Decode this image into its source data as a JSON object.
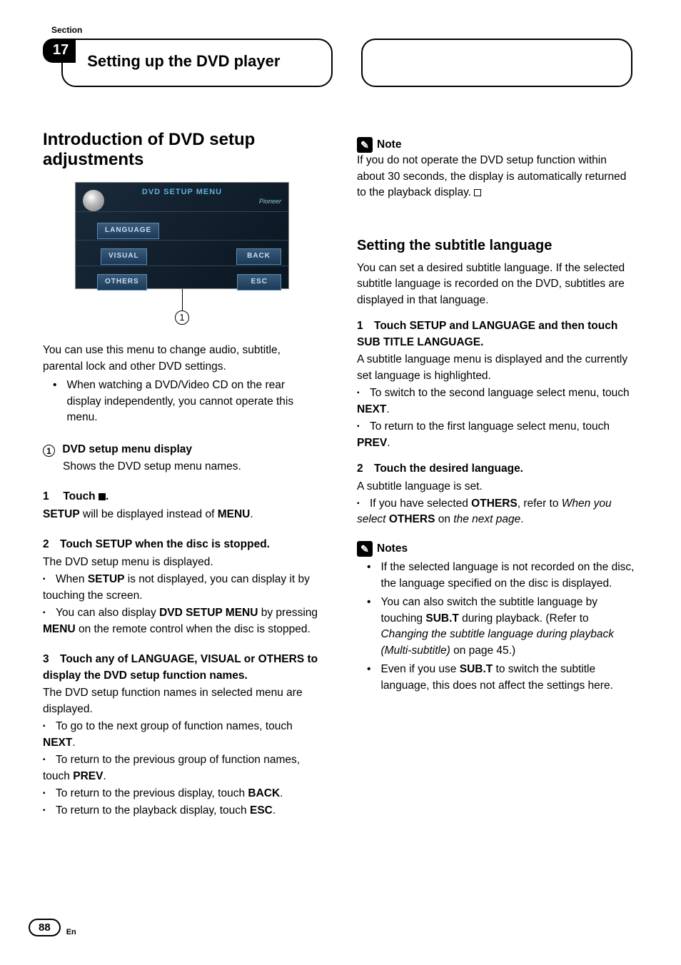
{
  "section_label": "Section",
  "chapter_number": "17",
  "chapter_title": "Setting up the DVD player",
  "page_number": "88",
  "lang_code": "En",
  "left": {
    "h2": "Introduction of DVD setup adjustments",
    "screenshot": {
      "title": "DVD SETUP MENU",
      "brand": "Pioneer",
      "btn_language": "LANGUAGE",
      "btn_visual": "VISUAL",
      "btn_others": "OTHERS",
      "btn_back": "BACK",
      "btn_esc": "ESC"
    },
    "callout": "1",
    "intro1": "You can use this menu to change audio, subtitle, parental lock and other DVD settings.",
    "intro_bullet": "When watching a DVD/Video CD on the rear display independently, you cannot operate this menu.",
    "legend_num": "1",
    "legend_title": "DVD setup menu display",
    "legend_desc": "Shows the DVD setup menu names.",
    "s1_num": "1",
    "s1_head_a": "Touch ",
    "s1_head_b": ".",
    "s1_body_a": "SETUP",
    "s1_body_b": " will be displayed instead of ",
    "s1_body_c": "MENU",
    "s1_body_d": ".",
    "s2_num": "2",
    "s2_head": "Touch SETUP when the disc is stopped.",
    "s2_body": "The DVD setup menu is displayed.",
    "s2_n1_a": "When ",
    "s2_n1_b": "SETUP",
    "s2_n1_c": " is not displayed, you can display it by touching the screen.",
    "s2_n2_a": "You can also display ",
    "s2_n2_b": "DVD SETUP MENU",
    "s2_n2_c": " by pressing ",
    "s2_n2_d": "MENU",
    "s2_n2_e": " on the remote control when the disc is stopped.",
    "s3_num": "3",
    "s3_head": "Touch any of LANGUAGE, VISUAL or OTHERS to display the DVD setup function names.",
    "s3_body": "The DVD setup function names in selected menu are displayed.",
    "s3_n1_a": "To go to the next group of function names, touch ",
    "s3_n1_b": "NEXT",
    "s3_n1_c": ".",
    "s3_n2_a": "To return to the previous group of function names, touch ",
    "s3_n2_b": "PREV",
    "s3_n2_c": ".",
    "s3_n3_a": "To return to the previous display, touch ",
    "s3_n3_b": "BACK",
    "s3_n3_c": ".",
    "s3_n4_a": "To return to the playback display, touch ",
    "s3_n4_b": "ESC",
    "s3_n4_c": "."
  },
  "right": {
    "note_label": "Note",
    "note_body": "If you do not operate the DVD setup function within about 30 seconds, the display is automatically returned to the playback display.",
    "h3": "Setting the subtitle language",
    "intro": "You can set a desired subtitle language. If the selected subtitle language is recorded on the DVD, subtitles are displayed in that language.",
    "s1_num": "1",
    "s1_head": "Touch SETUP and LANGUAGE and then touch SUB TITLE LANGUAGE.",
    "s1_body": "A subtitle language menu is displayed and the currently set language is highlighted.",
    "s1_n1_a": "To switch to the second language select menu, touch ",
    "s1_n1_b": "NEXT",
    "s1_n1_c": ".",
    "s1_n2_a": "To return to the first language select menu, touch ",
    "s1_n2_b": "PREV",
    "s1_n2_c": ".",
    "s2_num": "2",
    "s2_head": "Touch the desired language.",
    "s2_body": "A subtitle language is set.",
    "s2_n1_a": "If you have selected ",
    "s2_n1_b": "OTHERS",
    "s2_n1_c": ", refer to ",
    "s2_n1_d": "When you select ",
    "s2_n1_e": "OTHERS",
    "s2_n1_f": " on ",
    "s2_n1_g": "the next page",
    "s2_n1_h": ".",
    "notes_label": "Notes",
    "nb1": "If the selected language is not recorded on the disc, the language specified on the disc is displayed.",
    "nb2_a": "You can also switch the subtitle language by touching ",
    "nb2_b": "SUB.T",
    "nb2_c": " during playback. (Refer to ",
    "nb2_d": "Changing the subtitle language during playback (Multi-subtitle)",
    "nb2_e": " on page 45.)",
    "nb3_a": "Even if you use ",
    "nb3_b": "SUB.T",
    "nb3_c": " to switch the subtitle language, this does not affect the settings here."
  }
}
